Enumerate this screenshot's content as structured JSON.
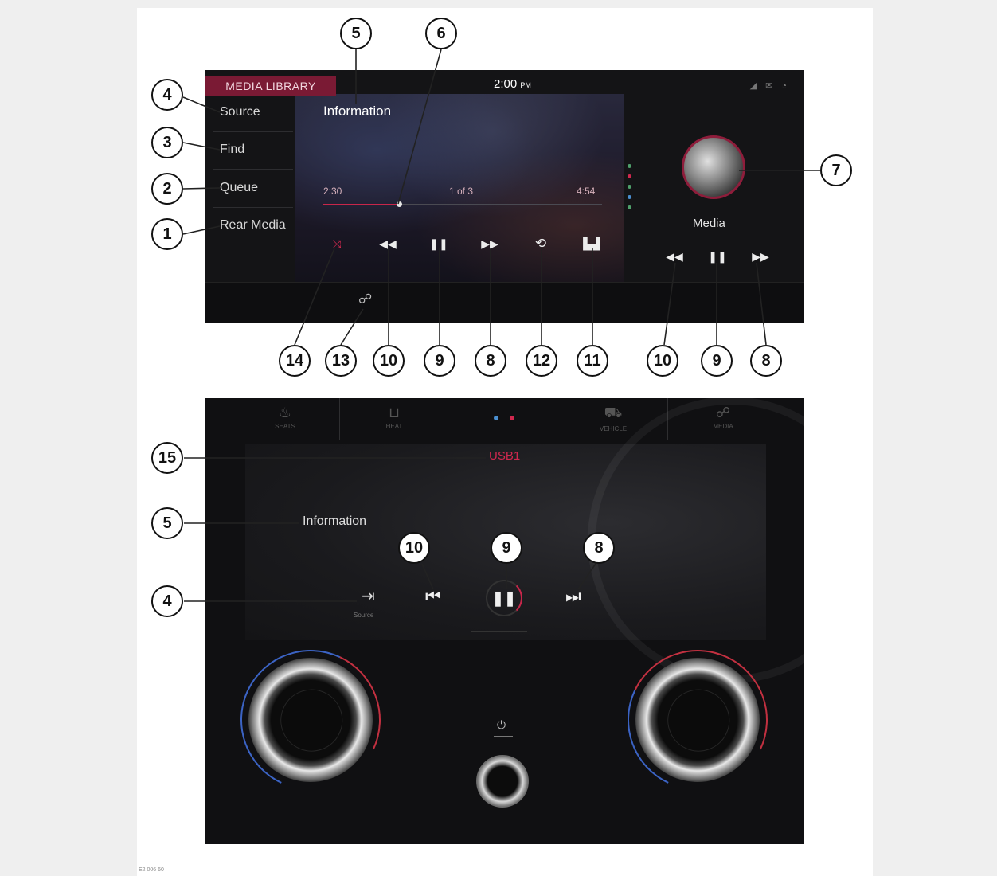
{
  "upper_screen": {
    "header_tag": "MEDIA LIBRARY",
    "clock": "2:00",
    "clock_suffix": "PM",
    "status_icons": "◢ ✉ ◔",
    "sidebar": [
      {
        "label": "Source"
      },
      {
        "label": "Find"
      },
      {
        "label": "Queue"
      },
      {
        "label": "Rear Media"
      }
    ],
    "info_title": "Information",
    "elapsed": "2:30",
    "track_index": "1 of 3",
    "duration": "4:54",
    "progress": 0.27,
    "dot_colors": [
      "#4fa06b",
      "#d0284e",
      "#4fa06b",
      "#4a8fd0",
      "#4fa06b"
    ],
    "controls": {
      "shuffle": "⤨",
      "rewind": "◀◀",
      "pause": "❚❚",
      "fast_forward": "▶▶",
      "repeat": "⟲",
      "similar": "▙▟"
    },
    "rear_media_label": "Media",
    "rear_controls": {
      "rewind": "◀◀",
      "pause": "❚❚",
      "fast_forward": "▶▶"
    },
    "link_icon": "☍"
  },
  "lower_panel": {
    "tabs": [
      {
        "icon": "♨",
        "label": "SEATS"
      },
      {
        "icon": "⊔",
        "label": "HEAT"
      },
      {
        "icon": "⛟",
        "label": "VEHICLE"
      },
      {
        "icon": "☍",
        "label": "MEDIA"
      }
    ],
    "source_name": "USB1",
    "info_title": "Information",
    "source_icon": "⇥",
    "source_label": "Source",
    "prev_icon": "⏮",
    "pause_icon": "❚❚",
    "next_icon": "⏭",
    "power_icon": "⏻"
  },
  "callouts": {
    "upper": [
      "5",
      "6",
      "4",
      "3",
      "2",
      "1",
      "7",
      "14",
      "13",
      "10",
      "9",
      "8",
      "12",
      "11",
      "10",
      "9",
      "8"
    ],
    "lower": [
      "15",
      "5",
      "10",
      "9",
      "8",
      "4"
    ]
  },
  "figure_id": "E2 006 60",
  "colors": {
    "accent": "#d0284e",
    "tag": "#7a1a34",
    "screen": "#141416"
  }
}
